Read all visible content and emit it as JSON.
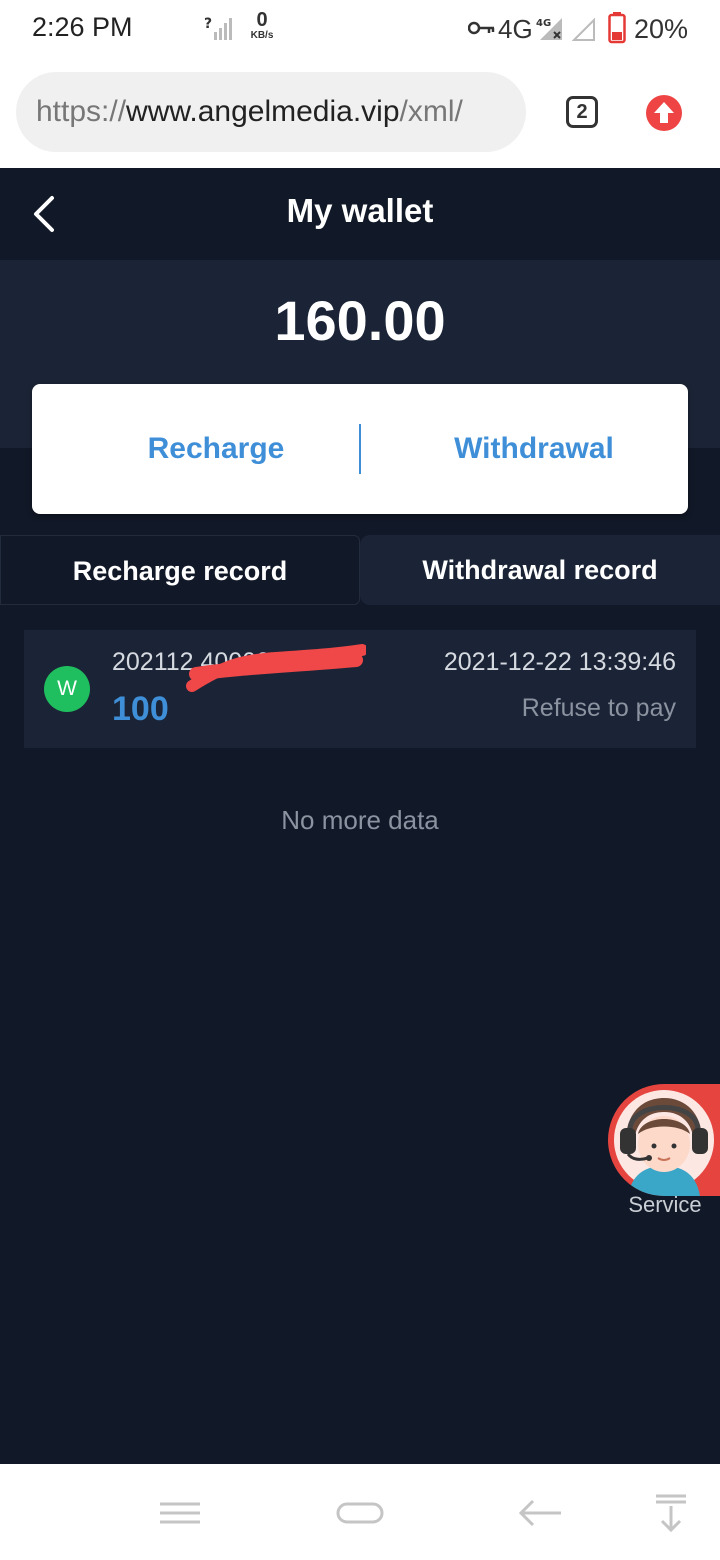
{
  "status_bar": {
    "time": "2:26 PM",
    "net_speed_value": "0",
    "net_speed_unit": "KB/s",
    "network_label": "4G",
    "battery_pct": "20%",
    "icons": [
      "signal-question-icon",
      "vpn-key-icon",
      "4g-signal-icon",
      "signal-icon",
      "battery-low-icon"
    ]
  },
  "browser": {
    "url_protocol": "https://",
    "url_host": "www.angelmedia.vip",
    "url_path": "/xml/",
    "tab_count": "2",
    "icons": [
      "update-arrow-icon"
    ]
  },
  "header": {
    "title": "My wallet",
    "back_icon": "chevron-left-icon"
  },
  "wallet": {
    "balance": "160.00",
    "recharge_label": "Recharge",
    "withdrawal_label": "Withdrawal"
  },
  "record_tabs": {
    "recharge": "Recharge record",
    "withdrawal": "Withdrawal record",
    "active": "withdrawal"
  },
  "records": [
    {
      "icon_letter": "W",
      "order_no": "202112 400003...",
      "amount": "100",
      "time": "2021-12-22 13:39:46",
      "status": "Refuse to pay"
    }
  ],
  "list_footer": "No more data",
  "service": {
    "label": "Service",
    "icon": "customer-service-avatar-icon"
  },
  "nav_bar": {
    "icons": [
      "menu-icon",
      "home-icon",
      "back-arrow-icon",
      "notification-pull-icon"
    ]
  },
  "colors": {
    "page_bg": "#111827",
    "card_bg": "#1b2436",
    "accent_blue": "#3f8fd8",
    "green": "#1fbf5f",
    "redaction": "#f04848"
  }
}
